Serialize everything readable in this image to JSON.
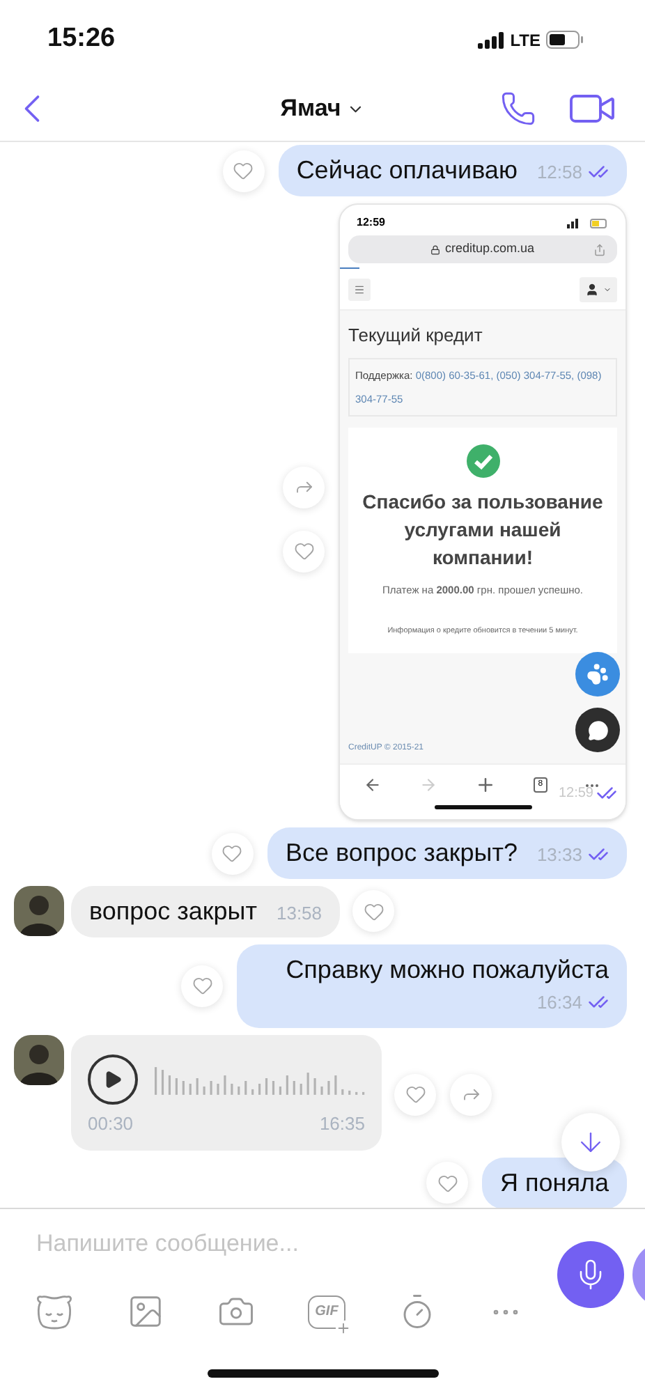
{
  "status_bar": {
    "time": "15:26",
    "network": "LTE"
  },
  "header": {
    "title": "Ямач"
  },
  "messages": [
    {
      "kind": "text",
      "outgoing": true,
      "text": "Сейчас оплачиваю",
      "time": "12:58",
      "read": true
    },
    {
      "kind": "image",
      "outgoing": true,
      "time": "12:59",
      "read": true,
      "screenshot": {
        "time": "12:59",
        "url": "creditup.com.ua",
        "page_title": "Текущий кредит",
        "support_label": "Поддержка:",
        "support_phones": "0(800) 60-35-61, (050) 304-77-55, (098) 304-77-55",
        "success_title": "Спасибо за пользование услугами нашей компании!",
        "payment_text": "Платеж на **2000.00** грн. прошел успешно.",
        "info_text": "Информация о кредите обновится в течении 5 минут.",
        "footer": "CreditUP © 2015-21",
        "tab_count": "8"
      }
    },
    {
      "kind": "text",
      "outgoing": true,
      "text": "Все вопрос закрыт?",
      "time": "13:33",
      "read": true
    },
    {
      "kind": "text",
      "outgoing": false,
      "text": "вопрос закрыт",
      "time": "13:58"
    },
    {
      "kind": "text",
      "outgoing": true,
      "text": "Справку можно пожалуйста",
      "time": "16:34",
      "read": true
    },
    {
      "kind": "voice",
      "outgoing": false,
      "duration": "00:30",
      "time": "16:35"
    },
    {
      "kind": "text",
      "outgoing": true,
      "text": "Я поняла"
    }
  ],
  "composer": {
    "placeholder": "Напишите сообщение...",
    "gif_label": "GIF"
  }
}
